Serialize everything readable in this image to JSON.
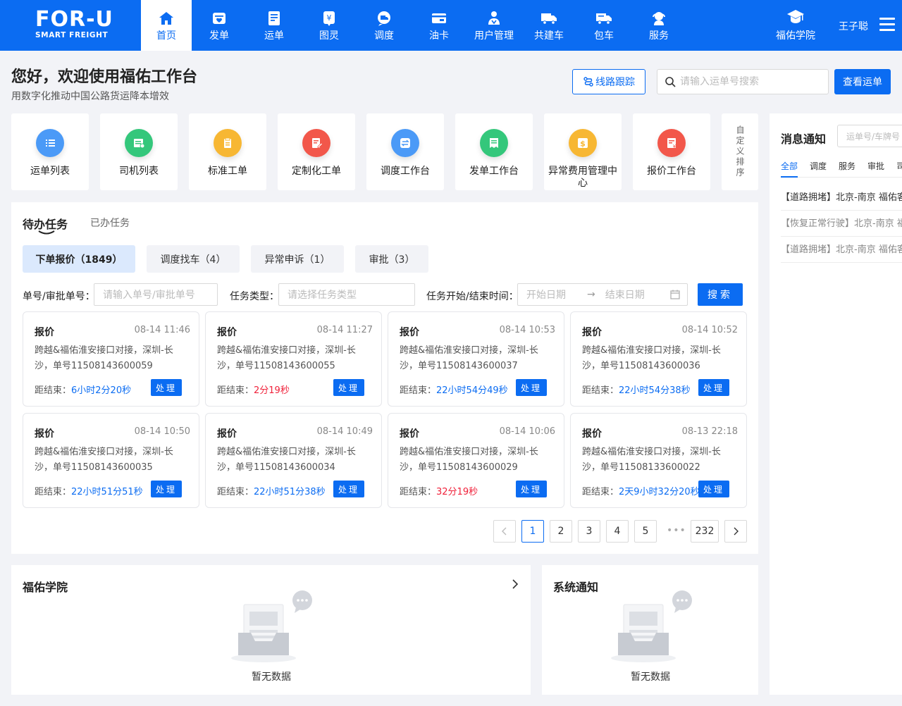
{
  "brand": {
    "main": "FOR-U",
    "sub": "SMART FREIGHT"
  },
  "nav": [
    {
      "label": "首页",
      "icon": "home-icon",
      "active": true
    },
    {
      "label": "发单",
      "icon": "send-order-icon"
    },
    {
      "label": "运单",
      "icon": "waybill-icon"
    },
    {
      "label": "图灵",
      "icon": "turing-icon"
    },
    {
      "label": "调度",
      "icon": "dispatch-icon"
    },
    {
      "label": "油卡",
      "icon": "fuel-card-icon"
    },
    {
      "label": "用户管理",
      "icon": "user-manage-icon"
    },
    {
      "label": "共建车",
      "icon": "shared-truck-icon"
    },
    {
      "label": "包车",
      "icon": "charter-truck-icon"
    },
    {
      "label": "服务",
      "icon": "service-icon"
    }
  ],
  "header_right": {
    "academy": "福佑学院",
    "user": "王子聪"
  },
  "welcome": {
    "title": "您好，欢迎使用福佑工作台",
    "subtitle": "用数字化推动中国公路货运降本增效"
  },
  "actions": {
    "track": "线路跟踪",
    "search_placeholder": "请输入运单号搜索",
    "view": "查看运单"
  },
  "tiles": [
    {
      "label": "运单列表",
      "icon": "list-icon",
      "color": "#4b9af7"
    },
    {
      "label": "司机列表",
      "icon": "driver-list-icon",
      "color": "#34c77b"
    },
    {
      "label": "标准工单",
      "icon": "clipboard-icon",
      "color": "#f7b733"
    },
    {
      "label": "定制化工单",
      "icon": "edit-doc-icon",
      "color": "#f2574a"
    },
    {
      "label": "调度工作台",
      "icon": "exchange-icon",
      "color": "#4b9af7"
    },
    {
      "label": "发单工作台",
      "icon": "receipt-icon",
      "color": "#34c77b"
    },
    {
      "label": "异常费用管理中心",
      "icon": "fee-icon",
      "color": "#f7b733"
    },
    {
      "label": "报价工作台",
      "icon": "quote-icon",
      "color": "#f2574a"
    }
  ],
  "custom_sort": "自定义排序",
  "tasks": {
    "tab_pending": "待办任务",
    "tab_done": "已办任务",
    "chips": [
      "下单报价（1849）",
      "调度找车（4）",
      "异常申诉（1）",
      "审批（3）"
    ],
    "filter": {
      "order_label": "单号/审批单号：",
      "order_placeholder": "请输入单号/审批单号",
      "type_label": "任务类型：",
      "type_placeholder": "请选择任务类型",
      "time_label": "任务开始/结束时间：",
      "start_placeholder": "开始日期",
      "end_placeholder": "结束日期",
      "search": "搜索"
    },
    "remaining_label": "距结束：",
    "process": "处理",
    "cards": [
      {
        "title": "报价",
        "time": "08-14 11:46",
        "desc": "跨越&福佑淮安接口对接，深圳-长沙，单号11508143600059",
        "remain": "6小时2分20秒",
        "urgent": false
      },
      {
        "title": "报价",
        "time": "08-14 11:27",
        "desc": "跨越&福佑淮安接口对接，深圳-长沙，单号11508143600055",
        "remain": "2分19秒",
        "urgent": true
      },
      {
        "title": "报价",
        "time": "08-14 10:53",
        "desc": "跨越&福佑淮安接口对接，深圳-长沙，单号11508143600037",
        "remain": "22小时54分49秒",
        "urgent": false
      },
      {
        "title": "报价",
        "time": "08-14 10:52",
        "desc": "跨越&福佑淮安接口对接，深圳-长沙，单号11508143600036",
        "remain": "22小时54分38秒",
        "urgent": false
      },
      {
        "title": "报价",
        "time": "08-14 10:50",
        "desc": "跨越&福佑淮安接口对接，深圳-长沙，单号11508143600035",
        "remain": "22小时51分51秒",
        "urgent": false
      },
      {
        "title": "报价",
        "time": "08-14 10:49",
        "desc": "跨越&福佑淮安接口对接，深圳-长沙，单号11508143600034",
        "remain": "22小时51分38秒",
        "urgent": false
      },
      {
        "title": "报价",
        "time": "08-14 10:06",
        "desc": "跨越&福佑淮安接口对接，深圳-长沙，单号11508143600029",
        "remain": "32分19秒",
        "urgent": true
      },
      {
        "title": "报价",
        "time": "08-13 22:18",
        "desc": "跨越&福佑淮安接口对接，深圳-长沙，单号11508133600022",
        "remain": "2天9小时32分20秒",
        "urgent": false
      }
    ],
    "pagination": {
      "pages": [
        "1",
        "2",
        "3",
        "4",
        "5"
      ],
      "current": "1",
      "ellipsis": "•••",
      "last": "232"
    }
  },
  "academy_panel": {
    "title": "福佑学院",
    "empty": "暂无数据"
  },
  "system_panel": {
    "title": "系统通知",
    "empty": "暂无数据"
  },
  "notifications": {
    "title": "消息通知",
    "search_placeholder": "运单号/车牌号",
    "tabs": [
      "全部",
      "调度",
      "服务",
      "审批",
      "司机"
    ],
    "items": [
      {
        "text": "【道路拥堵】北京-南京 福佑客服",
        "read": false
      },
      {
        "text": "【恢复正常行驶】北京-南京 福佑客服",
        "read": true
      },
      {
        "text": "【道路拥堵】北京-南京 福佑客服",
        "read": true
      }
    ]
  },
  "colors": {
    "brand": "#0b6cf2",
    "urgent": "#f0213a"
  }
}
